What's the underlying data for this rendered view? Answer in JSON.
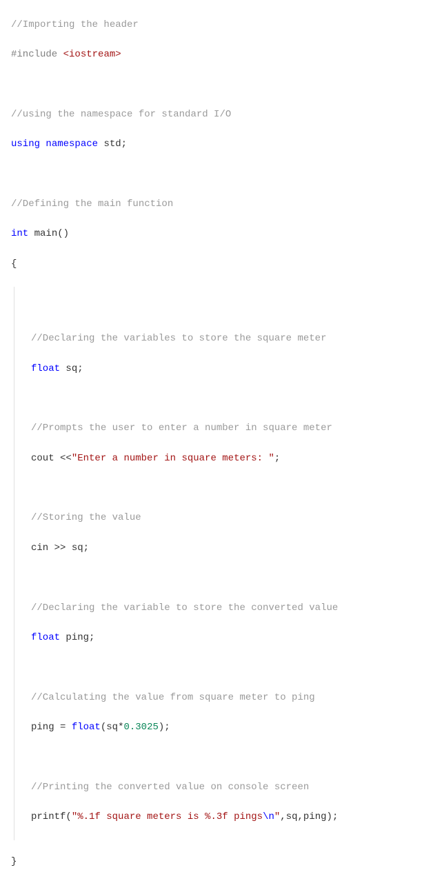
{
  "code": {
    "c1": "//Importing the header",
    "include_hash": "#include",
    "include_lt": "<",
    "include_hdr": "iostream",
    "include_gt": ">",
    "c2": "//using the namespace for standard I/O",
    "using_kw": "using",
    "namespace_kw": "namespace",
    "std_ident": "std",
    "semi": ";",
    "c3": "//Defining the main function",
    "int_kw": "int",
    "main_ident": "main",
    "parens": "()",
    "lbrace": "{",
    "c4": "//Declaring the variables to store the square meter",
    "float_kw": "float",
    "sq_ident": "sq",
    "c5": "//Prompts the user to enter a number in square meter",
    "cout_ident": "cout",
    "ltlt": "<<",
    "prompt_str": "\"Enter a number in square meters: \"",
    "c6": "//Storing the value",
    "cin_ident": "cin",
    "gtgt": ">>",
    "c7": "//Declaring the variable to store the converted value",
    "ping_ident": "ping",
    "c8": "//Calculating the value from square meter to ping",
    "eq": "=",
    "float_cast": "float",
    "lparen": "(",
    "mul": "*",
    "factor": "0.3025",
    "rparen": ")",
    "c9": "//Printing the converted value on console screen",
    "printf_ident": "printf",
    "fmt_part1": "\"%.1f square meters is %.3f pings",
    "fmt_escape": "\\n",
    "fmt_part2": "\"",
    "comma": ",",
    "rbrace": "}"
  }
}
